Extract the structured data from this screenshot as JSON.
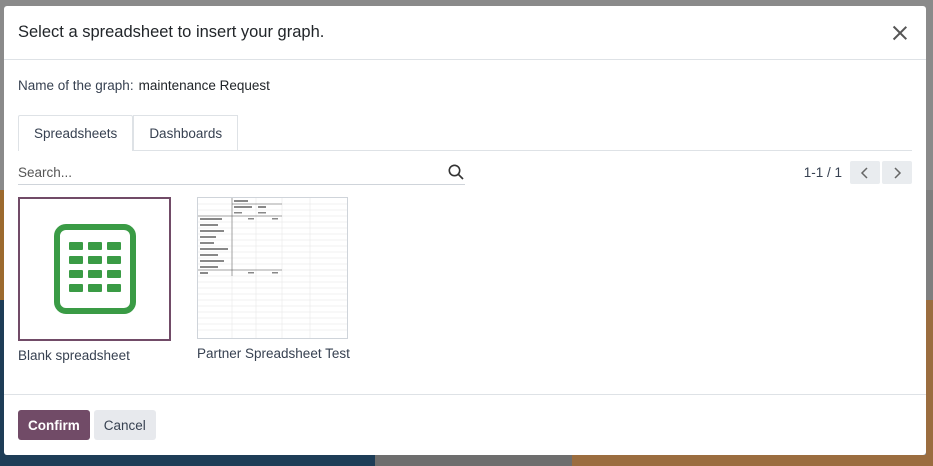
{
  "modal": {
    "title": "Select a spreadsheet to insert your graph.",
    "graph_name_label": "Name of the graph:",
    "graph_name_value": "maintenance Request"
  },
  "tabs": [
    {
      "label": "Spreadsheets",
      "active": true
    },
    {
      "label": "Dashboards",
      "active": false
    }
  ],
  "search": {
    "placeholder": "Search...",
    "value": ""
  },
  "pager": {
    "value": "1-1 / 1"
  },
  "spreadsheets": [
    {
      "label": "Blank spreadsheet",
      "icon": "spreadsheet-grid-icon",
      "selected": true
    },
    {
      "label": "Partner Spreadsheet Test",
      "icon": "spreadsheet-thumbnail",
      "selected": false
    }
  ],
  "footer": {
    "confirm_label": "Confirm",
    "cancel_label": "Cancel"
  },
  "colors": {
    "accent": "#714b67",
    "icon_green": "#3a9b45"
  }
}
